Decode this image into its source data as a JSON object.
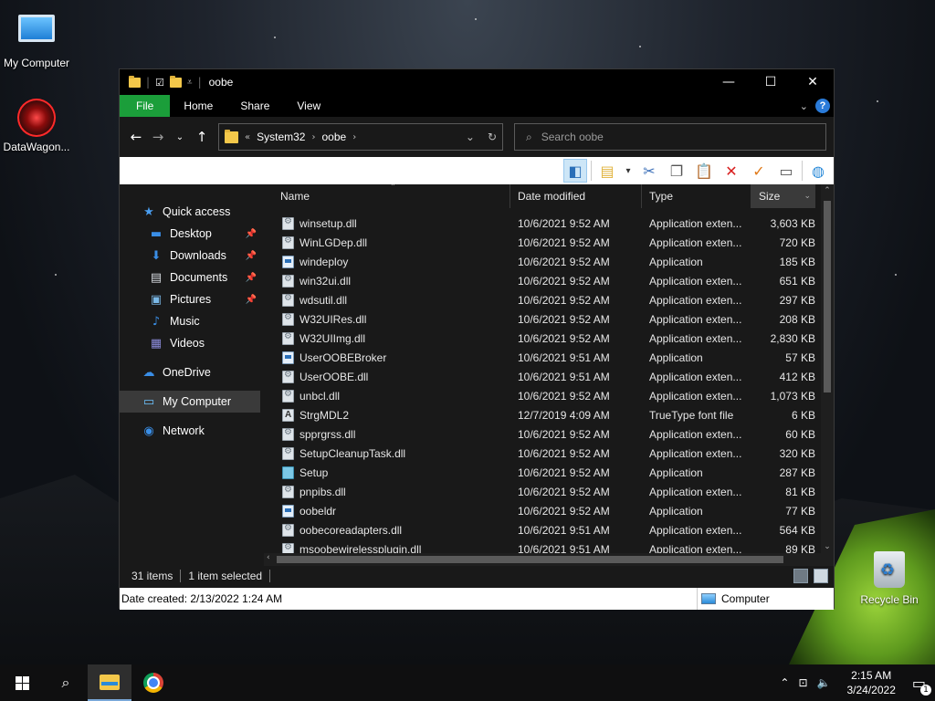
{
  "desktop": {
    "icons": [
      {
        "label": "My Computer"
      },
      {
        "label": "DataWagon..."
      },
      {
        "label": "Recycle Bin"
      }
    ]
  },
  "window": {
    "title": "oobe",
    "ribbon_tabs": [
      "File",
      "Home",
      "Share",
      "View"
    ],
    "address": {
      "prefix": "«",
      "crumbs": [
        "System32",
        "oobe"
      ]
    },
    "search": {
      "placeholder": "Search oobe"
    },
    "columns": {
      "name": "Name",
      "date": "Date modified",
      "type": "Type",
      "size": "Size"
    },
    "nav": [
      {
        "label": "Quick access",
        "icon": "star-icon",
        "glyph": "★",
        "color": "#4a9ef0",
        "sub": false,
        "pinned": false,
        "selected": false
      },
      {
        "label": "Desktop",
        "icon": "desktop-icon",
        "glyph": "▬",
        "color": "#3a8ee6",
        "sub": true,
        "pinned": true,
        "selected": false
      },
      {
        "label": "Downloads",
        "icon": "download-icon",
        "glyph": "⬇",
        "color": "#3a8ee6",
        "sub": true,
        "pinned": true,
        "selected": false
      },
      {
        "label": "Documents",
        "icon": "document-icon",
        "glyph": "▤",
        "color": "#d9dde2",
        "sub": true,
        "pinned": true,
        "selected": false
      },
      {
        "label": "Pictures",
        "icon": "pictures-icon",
        "glyph": "▣",
        "color": "#7ab8e6",
        "sub": true,
        "pinned": true,
        "selected": false
      },
      {
        "label": "Music",
        "icon": "music-icon",
        "glyph": "♪",
        "color": "#3a8ee6",
        "sub": true,
        "pinned": false,
        "selected": false
      },
      {
        "label": "Videos",
        "icon": "video-icon",
        "glyph": "▦",
        "color": "#8a8ad8",
        "sub": true,
        "pinned": false,
        "selected": false
      },
      {
        "label": "OneDrive",
        "icon": "cloud-icon",
        "glyph": "☁",
        "color": "#3a8ee6",
        "sub": false,
        "pinned": false,
        "selected": false,
        "gap": true
      },
      {
        "label": "My Computer",
        "icon": "computer-icon",
        "glyph": "▭",
        "color": "#6cc4ff",
        "sub": false,
        "pinned": false,
        "selected": true,
        "gap": true
      },
      {
        "label": "Network",
        "icon": "network-icon",
        "glyph": "◉",
        "color": "#3a8ee6",
        "sub": false,
        "pinned": false,
        "selected": false,
        "gap": true
      }
    ],
    "files": [
      {
        "name": "winsetup.dll",
        "date": "10/6/2021 9:52 AM",
        "type": "Application exten...",
        "size": "3,603 KB",
        "kind": "dll"
      },
      {
        "name": "WinLGDep.dll",
        "date": "10/6/2021 9:52 AM",
        "type": "Application exten...",
        "size": "720 KB",
        "kind": "dll"
      },
      {
        "name": "windeploy",
        "date": "10/6/2021 9:52 AM",
        "type": "Application",
        "size": "185 KB",
        "kind": "exe"
      },
      {
        "name": "win32ui.dll",
        "date": "10/6/2021 9:52 AM",
        "type": "Application exten...",
        "size": "651 KB",
        "kind": "dll"
      },
      {
        "name": "wdsutil.dll",
        "date": "10/6/2021 9:52 AM",
        "type": "Application exten...",
        "size": "297 KB",
        "kind": "dll"
      },
      {
        "name": "W32UIRes.dll",
        "date": "10/6/2021 9:52 AM",
        "type": "Application exten...",
        "size": "208 KB",
        "kind": "dll"
      },
      {
        "name": "W32UIImg.dll",
        "date": "10/6/2021 9:52 AM",
        "type": "Application exten...",
        "size": "2,830 KB",
        "kind": "dll"
      },
      {
        "name": "UserOOBEBroker",
        "date": "10/6/2021 9:51 AM",
        "type": "Application",
        "size": "57 KB",
        "kind": "exe"
      },
      {
        "name": "UserOOBE.dll",
        "date": "10/6/2021 9:51 AM",
        "type": "Application exten...",
        "size": "412 KB",
        "kind": "dll"
      },
      {
        "name": "unbcl.dll",
        "date": "10/6/2021 9:52 AM",
        "type": "Application exten...",
        "size": "1,073 KB",
        "kind": "dll"
      },
      {
        "name": "StrgMDL2",
        "date": "12/7/2019 4:09 AM",
        "type": "TrueType font file",
        "size": "6 KB",
        "kind": "font"
      },
      {
        "name": "spprgrss.dll",
        "date": "10/6/2021 9:52 AM",
        "type": "Application exten...",
        "size": "60 KB",
        "kind": "dll"
      },
      {
        "name": "SetupCleanupTask.dll",
        "date": "10/6/2021 9:52 AM",
        "type": "Application exten...",
        "size": "320 KB",
        "kind": "dll"
      },
      {
        "name": "Setup",
        "date": "10/6/2021 9:52 AM",
        "type": "Application",
        "size": "287 KB",
        "kind": "setup"
      },
      {
        "name": "pnpibs.dll",
        "date": "10/6/2021 9:52 AM",
        "type": "Application exten...",
        "size": "81 KB",
        "kind": "dll"
      },
      {
        "name": "oobeldr",
        "date": "10/6/2021 9:52 AM",
        "type": "Application",
        "size": "77 KB",
        "kind": "exe"
      },
      {
        "name": "oobecoreadapters.dll",
        "date": "10/6/2021 9:51 AM",
        "type": "Application exten...",
        "size": "564 KB",
        "kind": "dll"
      },
      {
        "name": "msoobewirelessplugin.dll",
        "date": "10/6/2021 9:51 AM",
        "type": "Application exten...",
        "size": "89 KB",
        "kind": "dll"
      }
    ],
    "status": {
      "items": "31 items",
      "selected": "1 item selected"
    },
    "info": {
      "date_created": "Date created: 2/13/2022 1:24 AM",
      "location": "Computer"
    }
  },
  "taskbar": {
    "time": "2:15 AM",
    "date": "3/24/2022",
    "notifications": "1"
  },
  "colors": {
    "file_tab": "#1b9e3a",
    "accent": "#2a7bd9"
  }
}
